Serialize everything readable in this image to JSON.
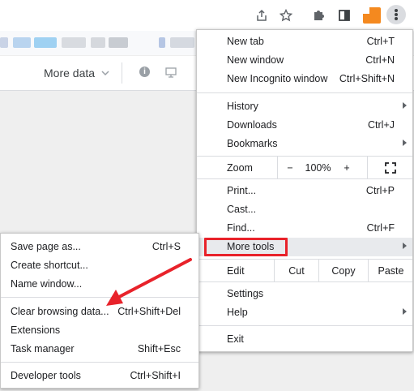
{
  "toolbar": {
    "icons": [
      "share-icon",
      "star-icon",
      "extensions-icon",
      "side-panel-icon",
      "profile-avatar",
      "kebab-menu-icon"
    ],
    "accent": "#f4891f"
  },
  "page": {
    "more_data": "More data"
  },
  "main_menu": {
    "new_tab": {
      "label": "New tab",
      "shortcut": "Ctrl+T"
    },
    "new_window": {
      "label": "New window",
      "shortcut": "Ctrl+N"
    },
    "new_incognito": {
      "label": "New Incognito window",
      "shortcut": "Ctrl+Shift+N"
    },
    "history": {
      "label": "History"
    },
    "downloads": {
      "label": "Downloads",
      "shortcut": "Ctrl+J"
    },
    "bookmarks": {
      "label": "Bookmarks"
    },
    "zoom": {
      "label": "Zoom",
      "minus": "−",
      "value": "100%",
      "plus": "+"
    },
    "print": {
      "label": "Print...",
      "shortcut": "Ctrl+P"
    },
    "cast": {
      "label": "Cast..."
    },
    "find": {
      "label": "Find...",
      "shortcut": "Ctrl+F"
    },
    "more_tools": {
      "label": "More tools"
    },
    "edit": {
      "label": "Edit",
      "cut": "Cut",
      "copy": "Copy",
      "paste": "Paste"
    },
    "settings": {
      "label": "Settings"
    },
    "help": {
      "label": "Help"
    },
    "exit": {
      "label": "Exit"
    }
  },
  "sub_menu": {
    "save_page": {
      "label": "Save page as...",
      "shortcut": "Ctrl+S"
    },
    "create_shortcut": {
      "label": "Create shortcut..."
    },
    "name_window": {
      "label": "Name window..."
    },
    "clear_browsing": {
      "label": "Clear browsing data...",
      "shortcut": "Ctrl+Shift+Del"
    },
    "extensions": {
      "label": "Extensions"
    },
    "task_manager": {
      "label": "Task manager",
      "shortcut": "Shift+Esc"
    },
    "developer_tools": {
      "label": "Developer tools",
      "shortcut": "Ctrl+Shift+I"
    }
  },
  "annotation": {
    "highlight_color": "#e8222a"
  }
}
